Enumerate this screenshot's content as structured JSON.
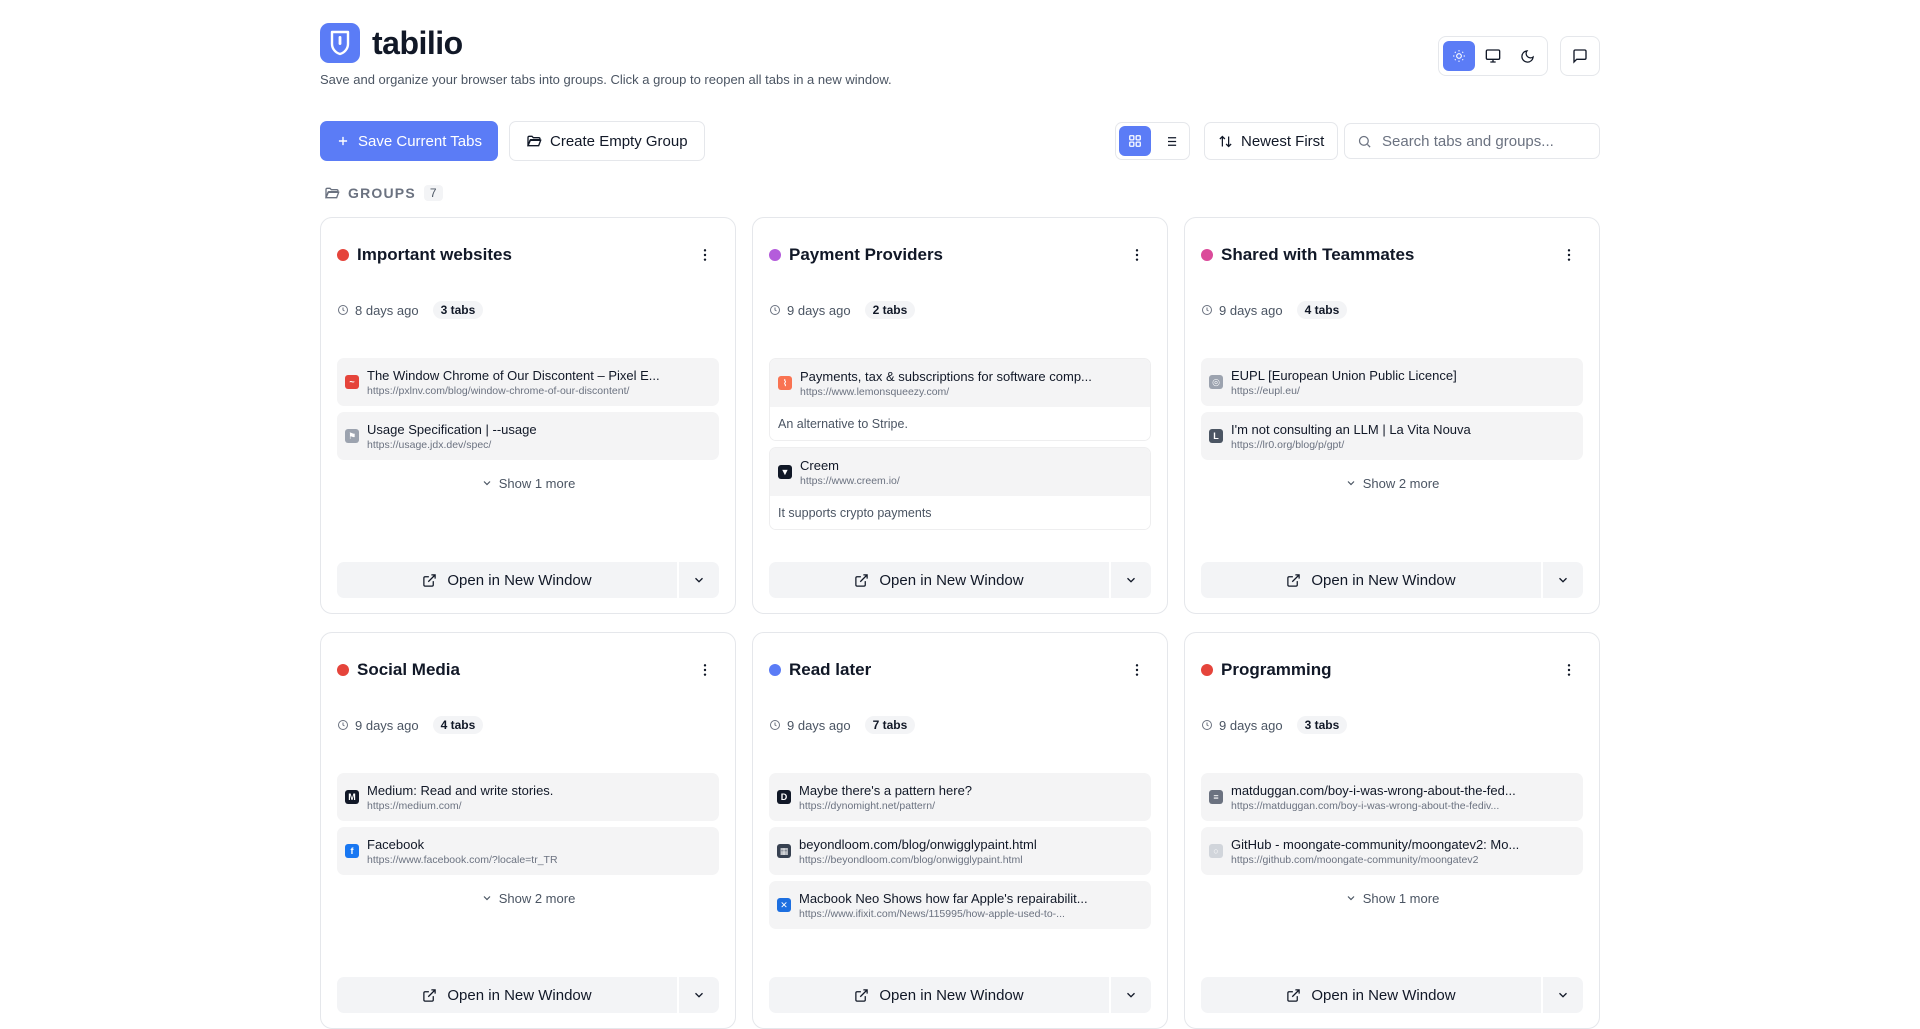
{
  "header": {
    "app_name": "tabilio",
    "tagline": "Save and organize your browser tabs into groups. Click a group to reopen all tabs in a new window.",
    "logo_icon": "lock-shield-icon",
    "accent": "#5b7cf6"
  },
  "theme_toggle": {
    "options": [
      "light",
      "system",
      "dark"
    ],
    "selected": "light"
  },
  "toolbar": {
    "save_label": "Save Current Tabs",
    "create_label": "Create Empty Group",
    "sort_label": "Newest First",
    "view_selected": "grid",
    "search_placeholder": "Search tabs and groups..."
  },
  "groups": {
    "label": "GROUPS",
    "count": "7",
    "open_label": "Open in New Window",
    "items": [
      {
        "title": "Important websites",
        "color": "#e5443b",
        "age": "8 days ago",
        "tab_count": "3 tabs",
        "tabs": [
          {
            "title": "The Window Chrome of Our Discontent – Pixel E...",
            "url": "https://pxlnv.com/blog/window-chrome-of-our-discontent/",
            "fav_color": "#e5443b",
            "fav_char": "~"
          },
          {
            "title": "Usage Specification | --usage",
            "url": "https://usage.jdx.dev/spec/",
            "fav_color": "#9ca3af",
            "fav_char": "⚑"
          }
        ],
        "show_more": "Show 1 more"
      },
      {
        "title": "Payment Providers",
        "color": "#b45cdb",
        "age": "9 days ago",
        "tab_count": "2 tabs",
        "tabs": [
          {
            "title": "Payments, tax & subscriptions for software comp...",
            "url": "https://www.lemonsqueezy.com/",
            "fav_color": "#f97352",
            "fav_char": "⌇",
            "note": "An alternative to Stripe."
          },
          {
            "title": "Creem",
            "url": "https://www.creem.io/",
            "fav_color": "#111827",
            "fav_char": "▼",
            "note": "It supports crypto payments"
          }
        ],
        "show_more": ""
      },
      {
        "title": "Shared with Teammates",
        "color": "#db4a9a",
        "age": "9 days ago",
        "tab_count": "4 tabs",
        "tabs": [
          {
            "title": "EUPL [European Union Public Licence]",
            "url": "https://eupl.eu/",
            "fav_color": "#9ca3af",
            "fav_char": "◎"
          },
          {
            "title": "I'm not consulting an LLM | La Vita Nouva",
            "url": "https://lr0.org/blog/p/gpt/",
            "fav_color": "#4b5563",
            "fav_char": "L"
          }
        ],
        "show_more": "Show 2 more"
      },
      {
        "title": "Social Media",
        "color": "#e5443b",
        "age": "9 days ago",
        "tab_count": "4 tabs",
        "tabs": [
          {
            "title": "Medium: Read and write stories.",
            "url": "https://medium.com/",
            "fav_color": "#111827",
            "fav_char": "M"
          },
          {
            "title": "Facebook",
            "url": "https://www.facebook.com/?locale=tr_TR",
            "fav_color": "#1877f2",
            "fav_char": "f"
          }
        ],
        "show_more": "Show 2 more"
      },
      {
        "title": "Read later",
        "color": "#5b7cf6",
        "age": "9 days ago",
        "tab_count": "7 tabs",
        "tabs": [
          {
            "title": "Maybe there's a pattern here?",
            "url": "https://dynomight.net/pattern/",
            "fav_color": "#111827",
            "fav_char": "D"
          },
          {
            "title": "beyondloom.com/blog/onwigglypaint.html",
            "url": "https://beyondloom.com/blog/onwigglypaint.html",
            "fav_color": "#374151",
            "fav_char": "▦"
          },
          {
            "title": "Macbook Neo Shows how far Apple's repairabilit...",
            "url": "https://www.ifixit.com/News/115995/how-apple-used-to-...",
            "fav_color": "#1d6fe0",
            "fav_char": "✕"
          }
        ],
        "show_more": ""
      },
      {
        "title": "Programming",
        "color": "#e5443b",
        "age": "9 days ago",
        "tab_count": "3 tabs",
        "tabs": [
          {
            "title": "matduggan.com/boy-i-was-wrong-about-the-fed...",
            "url": "https://matduggan.com/boy-i-was-wrong-about-the-fediv...",
            "fav_color": "#6b7280",
            "fav_char": "≡"
          },
          {
            "title": "GitHub - moongate-community/moongatev2: Mo...",
            "url": "https://github.com/moongate-community/moongatev2",
            "fav_color": "#d1d5db",
            "fav_char": "○"
          }
        ],
        "show_more": "Show 1 more"
      }
    ]
  }
}
